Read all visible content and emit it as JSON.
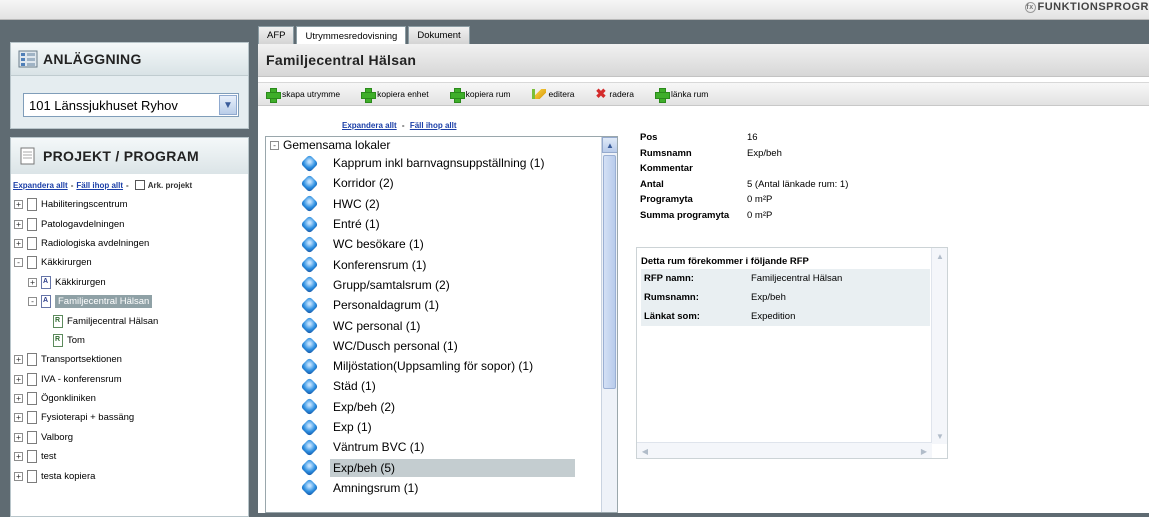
{
  "topbar": {
    "function_label": "FUNKTIONSPROGR",
    "fx_icon": "fx"
  },
  "anlaggning": {
    "title": "ANLÄGGNING",
    "selected": "101 Länssjukhuset Ryhov"
  },
  "projekt": {
    "title": "PROJEKT / PROGRAM",
    "expand_all": "Expandera allt",
    "collapse_all": "Fäll ihop allt",
    "separator": "-",
    "ark_label": "Ark. projekt",
    "tree": [
      {
        "label": "Habiliteringscentrum",
        "toggle": "+"
      },
      {
        "label": "Patologavdelningen",
        "toggle": "+"
      },
      {
        "label": "Radiologiska avdelningen",
        "toggle": "+"
      },
      {
        "label": "Käkkirurgen",
        "toggle": "-"
      },
      {
        "label": "Käkkirurgen",
        "toggle": "+"
      },
      {
        "label": "Familjecentral Hälsan",
        "toggle": "-"
      },
      {
        "label": "Familjecentral Hälsan"
      },
      {
        "label": "Tom"
      },
      {
        "label": "Transportsektionen",
        "toggle": "+"
      },
      {
        "label": "IVA - konferensrum",
        "toggle": "+"
      },
      {
        "label": "Ögonkliniken",
        "toggle": "+"
      },
      {
        "label": "Fysioterapi + bassäng",
        "toggle": "+"
      },
      {
        "label": "Valborg",
        "toggle": "+"
      },
      {
        "label": "test",
        "toggle": "+"
      },
      {
        "label": "testa kopiera",
        "toggle": "+"
      }
    ]
  },
  "tabs": [
    {
      "label": "AFP"
    },
    {
      "label": "Utrymmesredovisning"
    },
    {
      "label": "Dokument"
    }
  ],
  "main": {
    "title": "Familjecentral Hälsan",
    "toolbar": {
      "skapa": "skapa utrymme",
      "kopiera_enhet": "kopiera enhet",
      "kopiera_rum": "kopiera rum",
      "editera": "editera",
      "radera": "radera",
      "lanka": "länka rum"
    },
    "rooms_expand": "Expandera allt",
    "rooms_collapse": "Fäll ihop allt",
    "rooms_sep": "-",
    "group": {
      "toggle": "-",
      "label": "Gemensama lokaler"
    },
    "rooms": [
      "Kapprum inkl barnvagnsuppställning (1)",
      "Korridor (2)",
      "HWC (2)",
      "Entré (1)",
      "WC besökare (1)",
      "Konferensrum (1)",
      "Grupp/samtalsrum (2)",
      "Personaldagrum (1)",
      "WC personal (1)",
      "WC/Dusch personal (1)",
      "Miljöstation(Uppsamling för sopor) (1)",
      "Städ (1)",
      "Exp/beh (2)",
      "Exp (1)",
      "Väntrum BVC (1)",
      "Exp/beh (5)",
      "Amningsrum (1)"
    ],
    "selected_room_index": 15,
    "details": {
      "pos": {
        "key": "Pos",
        "value": "16"
      },
      "rumsnamn": {
        "key": "Rumsnamn",
        "value": "Exp/beh"
      },
      "kommentar": {
        "key": "Kommentar",
        "value": ""
      },
      "antal": {
        "key": "Antal",
        "value": "5 (Antal länkade rum: 1)"
      },
      "programyta": {
        "key": "Programyta",
        "value": "0 m²P"
      },
      "summa": {
        "key": "Summa programyta",
        "value": "0 m²P"
      }
    },
    "rfp": {
      "title": "Detta rum förekommer i följande RFP",
      "rows": [
        {
          "key": "RFP namn:",
          "value": "Familjecentral Hälsan"
        },
        {
          "key": "Rumsnamn:",
          "value": "Exp/beh"
        },
        {
          "key": "Länkat som:",
          "value": "Expedition"
        }
      ]
    }
  },
  "colors": {
    "background": "#5f6b72",
    "selection": "#8fa1a6",
    "link": "#1b3fa8",
    "plus_green": "#3fae2a",
    "delete_red": "#d42b2b"
  }
}
